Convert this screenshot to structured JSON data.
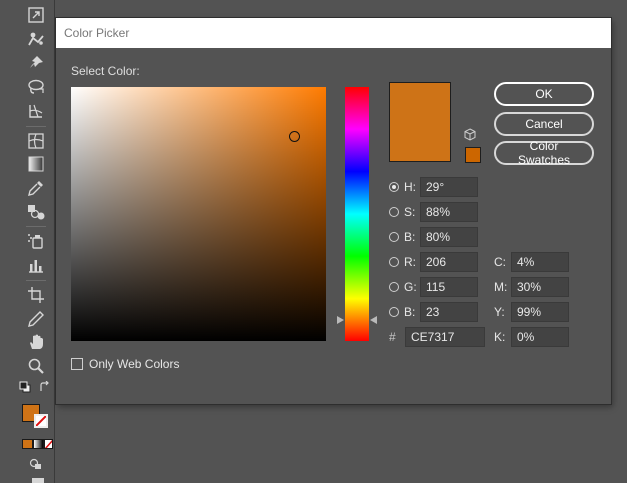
{
  "dialog": {
    "title": "Color Picker",
    "select_color_label": "Select Color:",
    "only_web_colors_label": "Only Web Colors",
    "only_web_colors_checked": false,
    "current_color_hex": "#CE7317",
    "hue_color_hex": "#FF7B00",
    "websafe_color_hex": "#CC6600"
  },
  "buttons": {
    "ok": "OK",
    "cancel": "Cancel",
    "color_swatches": "Color Swatches"
  },
  "fields": {
    "h": {
      "label": "H:",
      "value": "29°",
      "selected": true
    },
    "s": {
      "label": "S:",
      "value": "88%"
    },
    "bri": {
      "label": "B:",
      "value": "80%"
    },
    "r": {
      "label": "R:",
      "value": "206"
    },
    "g": {
      "label": "G:",
      "value": "115"
    },
    "blue": {
      "label": "B:",
      "value": "23"
    },
    "hex": {
      "label": "#",
      "value": "CE7317"
    },
    "c": {
      "label": "C:",
      "value": "4%"
    },
    "m": {
      "label": "M:",
      "value": "30%"
    },
    "y": {
      "label": "Y:",
      "value": "99%"
    },
    "k": {
      "label": "K:",
      "value": "0%"
    }
  },
  "toolbar": {
    "icons": [
      "free-transform-icon",
      "puppet-warp-icon",
      "pin-icon",
      "lasso-icon",
      "mesh-icon",
      "gradient-mesh-icon",
      "gradient-icon",
      "eyedropper-icon",
      "blend-icon",
      "symbol-sprayer-icon",
      "column-graph-icon",
      "artboard-icon",
      "slice-icon",
      "hand-icon",
      "zoom-icon"
    ],
    "fill_color_hex": "#CF7316"
  }
}
